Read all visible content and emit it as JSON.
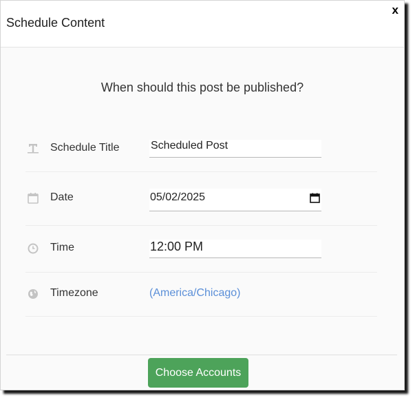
{
  "modal": {
    "title": "Schedule Content",
    "close_label": "x"
  },
  "question": "When should this post be published?",
  "form": {
    "schedule_title": {
      "label": "Schedule Title",
      "value": "Scheduled Post",
      "icon": "text-format-icon"
    },
    "date": {
      "label": "Date",
      "value": "05/02/2025",
      "icon": "calendar-icon"
    },
    "time": {
      "label": "Time",
      "value": "12:00 PM",
      "icon": "clock-icon"
    },
    "timezone": {
      "label": "Timezone",
      "value": "(America/Chicago)",
      "icon": "globe-icon"
    }
  },
  "footer": {
    "choose_accounts_label": "Choose Accounts"
  },
  "colors": {
    "primary_button": "#4da35a",
    "link": "#5b8fd8",
    "icon_gray": "#c4c4c4"
  }
}
